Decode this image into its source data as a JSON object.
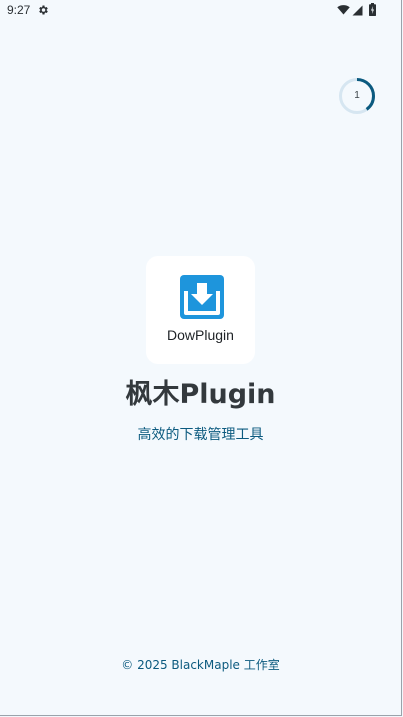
{
  "status_bar": {
    "time": "9:27",
    "icons": [
      "settings-icon",
      "wifi-icon",
      "signal-icon",
      "battery-icon"
    ]
  },
  "countdown": {
    "value": "1",
    "progress_fraction": 0.4,
    "color": "#0b5a7f",
    "track_color": "#d6e6f1"
  },
  "logo": {
    "icon": "download-icon",
    "text": "DowPlugin",
    "icon_color": "#1e95dc"
  },
  "app": {
    "name": "枫木Plugin",
    "subtitle": "高效的下载管理工具"
  },
  "footer": {
    "copyright": "© 2025 BlackMaple 工作室"
  },
  "colors": {
    "background": "#f4f9fd",
    "accent": "#0b5a7f",
    "title": "#33393d"
  }
}
